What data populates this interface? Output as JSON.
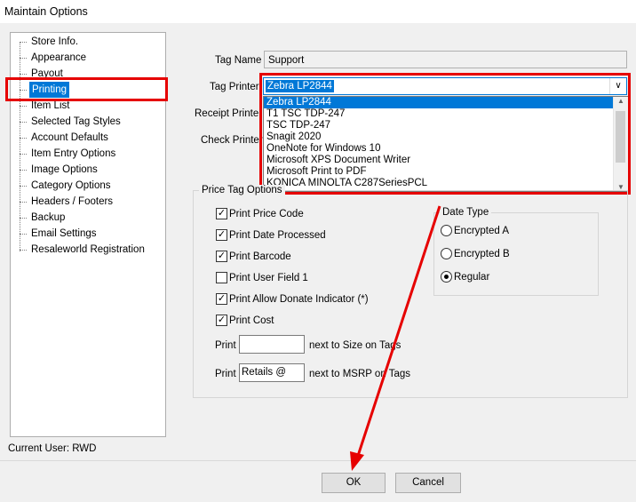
{
  "window": {
    "title": "Maintain Options"
  },
  "tree": {
    "items": [
      "Store Info.",
      "Appearance",
      "Payout",
      "Printing",
      "Item List",
      "Selected Tag Styles",
      "Account Defaults",
      "Item Entry Options",
      "Image Options",
      "Category Options",
      "Headers / Footers",
      "Backup",
      "Email Settings",
      "Resaleworld Registration"
    ],
    "selected": "Printing"
  },
  "form": {
    "tag_name_label": "Tag Name",
    "tag_name_value": "Support",
    "tag_printer_label": "Tag Printer",
    "tag_printer_value": "Zebra LP2844",
    "receipt_printer_label": "Receipt Printer",
    "check_printer_label": "Check Printer"
  },
  "printer_dropdown": {
    "options": [
      "Zebra LP2844",
      "T1 TSC TDP-247",
      "TSC TDP-247",
      "Snagit 2020",
      "OneNote for Windows 10",
      "Microsoft XPS Document Writer",
      "Microsoft Print to PDF",
      "KONICA MINOLTA C287SeriesPCL"
    ],
    "highlighted": "Zebra LP2844"
  },
  "price_tag": {
    "title": "Price Tag Options",
    "checkboxes": [
      {
        "label": "Print Price Code",
        "checked": true
      },
      {
        "label": "Print Date Processed",
        "checked": true
      },
      {
        "label": "Print Barcode",
        "checked": true
      },
      {
        "label": "Print User Field 1",
        "checked": false
      },
      {
        "label": "Print Allow Donate Indicator (*)",
        "checked": true
      },
      {
        "label": "Print Cost",
        "checked": true
      }
    ],
    "print_label": "Print",
    "size_value": "",
    "size_suffix": "next to Size on Tags",
    "msrp_value": "Retails @",
    "msrp_suffix": "next to MSRP on Tags"
  },
  "date_type": {
    "title": "Date Type",
    "options": [
      {
        "label": "Encrypted A",
        "selected": false
      },
      {
        "label": "Encrypted B",
        "selected": false
      },
      {
        "label": "Regular",
        "selected": true
      }
    ]
  },
  "footer": {
    "current_user": "Current User: RWD",
    "ok_label": "OK",
    "cancel_label": "Cancel"
  },
  "colors": {
    "annotation": "#e60000",
    "selection": "#0078d7"
  }
}
